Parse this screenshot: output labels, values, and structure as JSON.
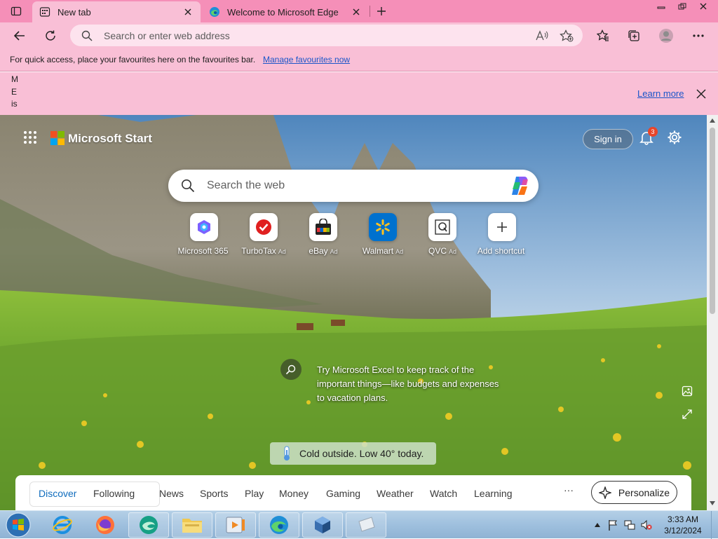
{
  "browser": {
    "tabs": [
      {
        "title": "New tab",
        "active": true
      },
      {
        "title": "Welcome to Microsoft Edge",
        "active": false
      }
    ],
    "address": {
      "placeholder": "Search or enter web address",
      "value": ""
    }
  },
  "favourites_bar": {
    "message": "For quick access, place your favourites here on the favourites bar.",
    "link": "Manage favourites now"
  },
  "infobar": {
    "text": "M E is",
    "learn_more": "Learn more"
  },
  "newtab": {
    "brand": "Microsoft Start",
    "sign_in": "Sign in",
    "notification_count": "3",
    "search_placeholder": "Search the web",
    "shortcuts": [
      {
        "label": "Microsoft 365",
        "ad": ""
      },
      {
        "label": "TurboTax",
        "ad": "Ad"
      },
      {
        "label": "eBay",
        "ad": "Ad"
      },
      {
        "label": "Walmart",
        "ad": "Ad"
      },
      {
        "label": "QVC",
        "ad": "Ad"
      },
      {
        "label": "Add shortcut",
        "ad": ""
      }
    ],
    "tip": "Try Microsoft Excel to keep track of the important things—like budgets and expenses to vacation plans.",
    "weather": "Cold outside. Low 40° today.",
    "feed_tabs": [
      "Discover",
      "Following",
      "News",
      "Sports",
      "Play",
      "Money",
      "Gaming",
      "Weather",
      "Watch",
      "Learning"
    ],
    "feed_more": "···",
    "personalize": "Personalize"
  },
  "taskbar": {
    "time": "3:33 AM",
    "date": "3/12/2024"
  },
  "colors": {
    "tab_strip": "#f58fb8",
    "toolbar": "#f9bfd6",
    "link": "#1a55c9",
    "accent": "#0f6cbd",
    "taskbar": "#9fc0de"
  }
}
